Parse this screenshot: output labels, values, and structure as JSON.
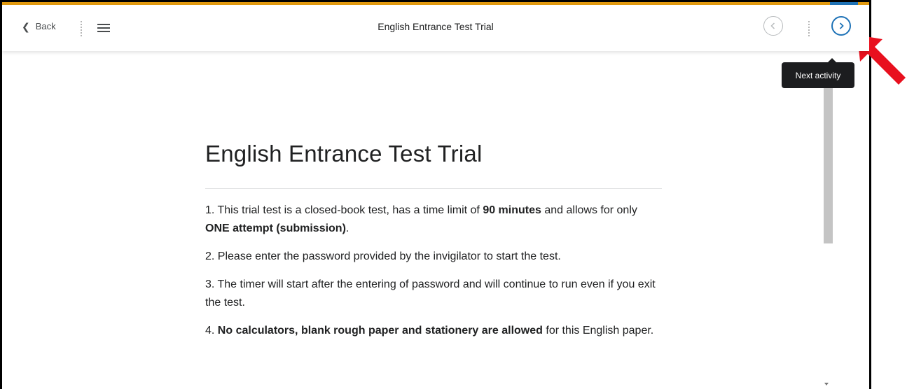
{
  "header": {
    "back_label": "Back",
    "title": "English Entrance Test Trial",
    "icons": [
      "chevron-left-icon",
      "menu-icon",
      "previous-activity-icon",
      "next-activity-icon"
    ]
  },
  "tooltip": {
    "text": "Next activity"
  },
  "main": {
    "heading": "English Entrance Test Trial",
    "paragraphs": [
      {
        "p1": "1. This trial test is a closed-book test, has a time limit of ",
        "b1": "90 minutes",
        "p2": " and allows for only ",
        "b2": "ONE attempt (submission)",
        "p3": "."
      },
      {
        "text": "2. Please enter the password provided by the invigilator to start the test."
      },
      {
        "text": "3. The timer will start after the entering of password and will continue to run even if you exit the test."
      },
      {
        "p1": "4. ",
        "b1": "No calculators, blank rough paper and stationery are allowed",
        "p2": " for this English paper."
      }
    ]
  },
  "colors": {
    "accent_bar": "#e49b0f",
    "next_button": "#1f73b7",
    "tooltip_bg": "#1c1d1f",
    "annotation_arrow": "#e8101e"
  }
}
